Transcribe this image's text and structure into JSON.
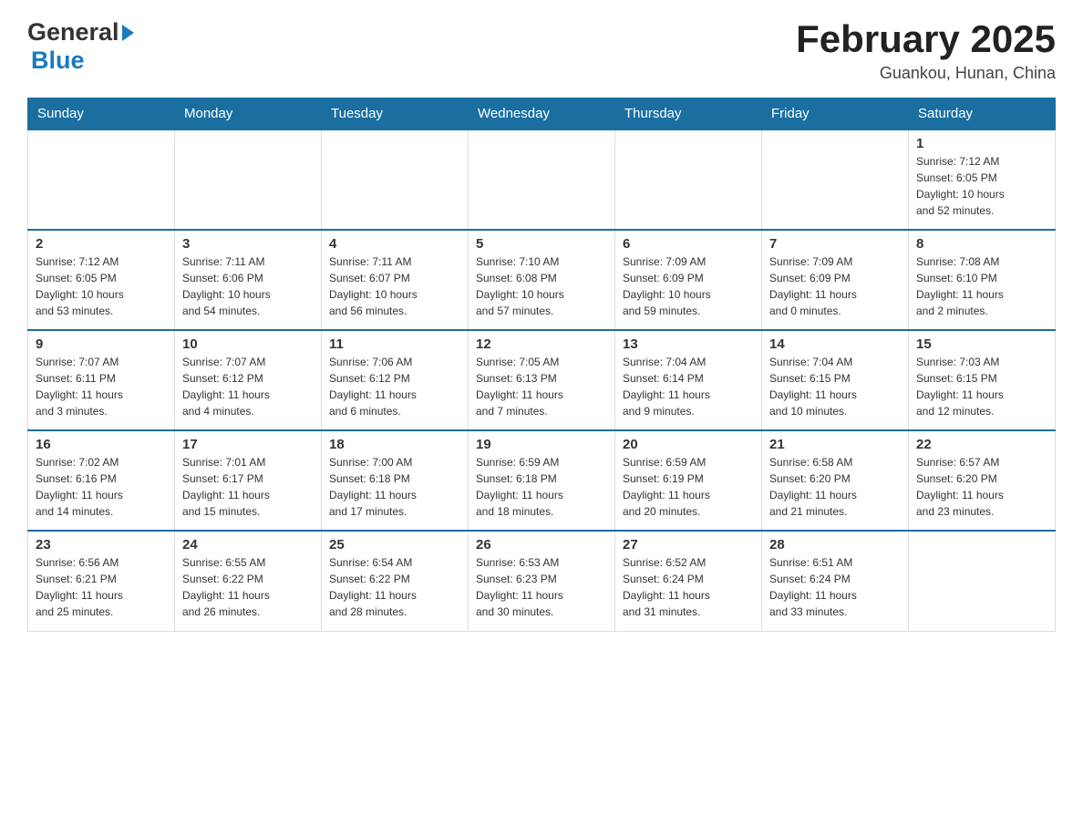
{
  "header": {
    "logo_general": "General",
    "logo_blue": "Blue",
    "title": "February 2025",
    "subtitle": "Guankou, Hunan, China"
  },
  "days_of_week": [
    "Sunday",
    "Monday",
    "Tuesday",
    "Wednesday",
    "Thursday",
    "Friday",
    "Saturday"
  ],
  "weeks": [
    {
      "days": [
        {
          "number": "",
          "info": "",
          "empty": true
        },
        {
          "number": "",
          "info": "",
          "empty": true
        },
        {
          "number": "",
          "info": "",
          "empty": true
        },
        {
          "number": "",
          "info": "",
          "empty": true
        },
        {
          "number": "",
          "info": "",
          "empty": true
        },
        {
          "number": "",
          "info": "",
          "empty": true
        },
        {
          "number": "1",
          "info": "Sunrise: 7:12 AM\nSunset: 6:05 PM\nDaylight: 10 hours\nand 52 minutes.",
          "empty": false
        }
      ]
    },
    {
      "days": [
        {
          "number": "2",
          "info": "Sunrise: 7:12 AM\nSunset: 6:05 PM\nDaylight: 10 hours\nand 53 minutes.",
          "empty": false
        },
        {
          "number": "3",
          "info": "Sunrise: 7:11 AM\nSunset: 6:06 PM\nDaylight: 10 hours\nand 54 minutes.",
          "empty": false
        },
        {
          "number": "4",
          "info": "Sunrise: 7:11 AM\nSunset: 6:07 PM\nDaylight: 10 hours\nand 56 minutes.",
          "empty": false
        },
        {
          "number": "5",
          "info": "Sunrise: 7:10 AM\nSunset: 6:08 PM\nDaylight: 10 hours\nand 57 minutes.",
          "empty": false
        },
        {
          "number": "6",
          "info": "Sunrise: 7:09 AM\nSunset: 6:09 PM\nDaylight: 10 hours\nand 59 minutes.",
          "empty": false
        },
        {
          "number": "7",
          "info": "Sunrise: 7:09 AM\nSunset: 6:09 PM\nDaylight: 11 hours\nand 0 minutes.",
          "empty": false
        },
        {
          "number": "8",
          "info": "Sunrise: 7:08 AM\nSunset: 6:10 PM\nDaylight: 11 hours\nand 2 minutes.",
          "empty": false
        }
      ]
    },
    {
      "days": [
        {
          "number": "9",
          "info": "Sunrise: 7:07 AM\nSunset: 6:11 PM\nDaylight: 11 hours\nand 3 minutes.",
          "empty": false
        },
        {
          "number": "10",
          "info": "Sunrise: 7:07 AM\nSunset: 6:12 PM\nDaylight: 11 hours\nand 4 minutes.",
          "empty": false
        },
        {
          "number": "11",
          "info": "Sunrise: 7:06 AM\nSunset: 6:12 PM\nDaylight: 11 hours\nand 6 minutes.",
          "empty": false
        },
        {
          "number": "12",
          "info": "Sunrise: 7:05 AM\nSunset: 6:13 PM\nDaylight: 11 hours\nand 7 minutes.",
          "empty": false
        },
        {
          "number": "13",
          "info": "Sunrise: 7:04 AM\nSunset: 6:14 PM\nDaylight: 11 hours\nand 9 minutes.",
          "empty": false
        },
        {
          "number": "14",
          "info": "Sunrise: 7:04 AM\nSunset: 6:15 PM\nDaylight: 11 hours\nand 10 minutes.",
          "empty": false
        },
        {
          "number": "15",
          "info": "Sunrise: 7:03 AM\nSunset: 6:15 PM\nDaylight: 11 hours\nand 12 minutes.",
          "empty": false
        }
      ]
    },
    {
      "days": [
        {
          "number": "16",
          "info": "Sunrise: 7:02 AM\nSunset: 6:16 PM\nDaylight: 11 hours\nand 14 minutes.",
          "empty": false
        },
        {
          "number": "17",
          "info": "Sunrise: 7:01 AM\nSunset: 6:17 PM\nDaylight: 11 hours\nand 15 minutes.",
          "empty": false
        },
        {
          "number": "18",
          "info": "Sunrise: 7:00 AM\nSunset: 6:18 PM\nDaylight: 11 hours\nand 17 minutes.",
          "empty": false
        },
        {
          "number": "19",
          "info": "Sunrise: 6:59 AM\nSunset: 6:18 PM\nDaylight: 11 hours\nand 18 minutes.",
          "empty": false
        },
        {
          "number": "20",
          "info": "Sunrise: 6:59 AM\nSunset: 6:19 PM\nDaylight: 11 hours\nand 20 minutes.",
          "empty": false
        },
        {
          "number": "21",
          "info": "Sunrise: 6:58 AM\nSunset: 6:20 PM\nDaylight: 11 hours\nand 21 minutes.",
          "empty": false
        },
        {
          "number": "22",
          "info": "Sunrise: 6:57 AM\nSunset: 6:20 PM\nDaylight: 11 hours\nand 23 minutes.",
          "empty": false
        }
      ]
    },
    {
      "days": [
        {
          "number": "23",
          "info": "Sunrise: 6:56 AM\nSunset: 6:21 PM\nDaylight: 11 hours\nand 25 minutes.",
          "empty": false
        },
        {
          "number": "24",
          "info": "Sunrise: 6:55 AM\nSunset: 6:22 PM\nDaylight: 11 hours\nand 26 minutes.",
          "empty": false
        },
        {
          "number": "25",
          "info": "Sunrise: 6:54 AM\nSunset: 6:22 PM\nDaylight: 11 hours\nand 28 minutes.",
          "empty": false
        },
        {
          "number": "26",
          "info": "Sunrise: 6:53 AM\nSunset: 6:23 PM\nDaylight: 11 hours\nand 30 minutes.",
          "empty": false
        },
        {
          "number": "27",
          "info": "Sunrise: 6:52 AM\nSunset: 6:24 PM\nDaylight: 11 hours\nand 31 minutes.",
          "empty": false
        },
        {
          "number": "28",
          "info": "Sunrise: 6:51 AM\nSunset: 6:24 PM\nDaylight: 11 hours\nand 33 minutes.",
          "empty": false
        },
        {
          "number": "",
          "info": "",
          "empty": true
        }
      ]
    }
  ]
}
